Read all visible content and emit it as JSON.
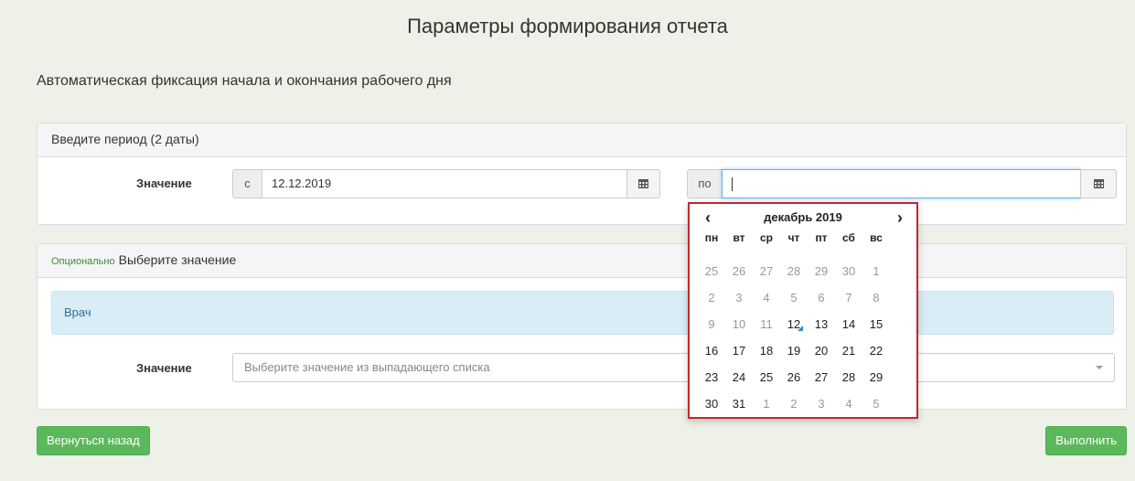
{
  "page": {
    "title": "Параметры формирования отчета",
    "subtitle": "Автоматическая фиксация начала и окончания рабочего дня"
  },
  "period_panel": {
    "heading": "Введите период (2 даты)",
    "value_label": "Значение",
    "from_prefix": "с",
    "from_value": "12.12.2019",
    "to_prefix": "по",
    "to_value": ""
  },
  "optional_panel": {
    "optional_tag": "Опционально",
    "heading": "Выберите значение",
    "info_label": "Врач",
    "value_label": "Значение",
    "select_placeholder": "Выберите значение из выпадающего списка"
  },
  "buttons": {
    "back": "Вернуться назад",
    "run": "Выполнить"
  },
  "datepicker": {
    "month_label": "декабрь 2019",
    "prev": "‹",
    "next": "›",
    "weekdays": [
      "пн",
      "вт",
      "ср",
      "чт",
      "пт",
      "сб",
      "вс"
    ],
    "weeks": [
      [
        "25",
        "26",
        "27",
        "28",
        "29",
        "30",
        "1"
      ],
      [
        "2",
        "3",
        "4",
        "5",
        "6",
        "7",
        "8"
      ],
      [
        "9",
        "10",
        "11",
        "12",
        "13",
        "14",
        "15"
      ],
      [
        "16",
        "17",
        "18",
        "19",
        "20",
        "21",
        "22"
      ],
      [
        "23",
        "24",
        "25",
        "26",
        "27",
        "28",
        "29"
      ],
      [
        "30",
        "31",
        "1",
        "2",
        "3",
        "4",
        "5"
      ]
    ],
    "day_state": [
      [
        "old",
        "old",
        "old",
        "old",
        "old",
        "old",
        "disabled"
      ],
      [
        "disabled",
        "disabled",
        "disabled",
        "disabled",
        "disabled",
        "disabled",
        "disabled"
      ],
      [
        "disabled",
        "disabled",
        "disabled",
        "today",
        "active",
        "active",
        "active"
      ],
      [
        "active",
        "active",
        "active",
        "active",
        "active",
        "active",
        "active"
      ],
      [
        "active",
        "active",
        "active",
        "active",
        "active",
        "active",
        "active"
      ],
      [
        "active",
        "active",
        "new",
        "new",
        "new",
        "new",
        "new"
      ]
    ]
  },
  "colors": {
    "page_bg": "#eef1e8",
    "primary_green": "#5cb85c",
    "info_bg": "#d9edf7",
    "info_text": "#31708f",
    "focus_border": "#66afe9",
    "highlight_border": "#c0282d",
    "today_marker": "#3a87c8"
  }
}
